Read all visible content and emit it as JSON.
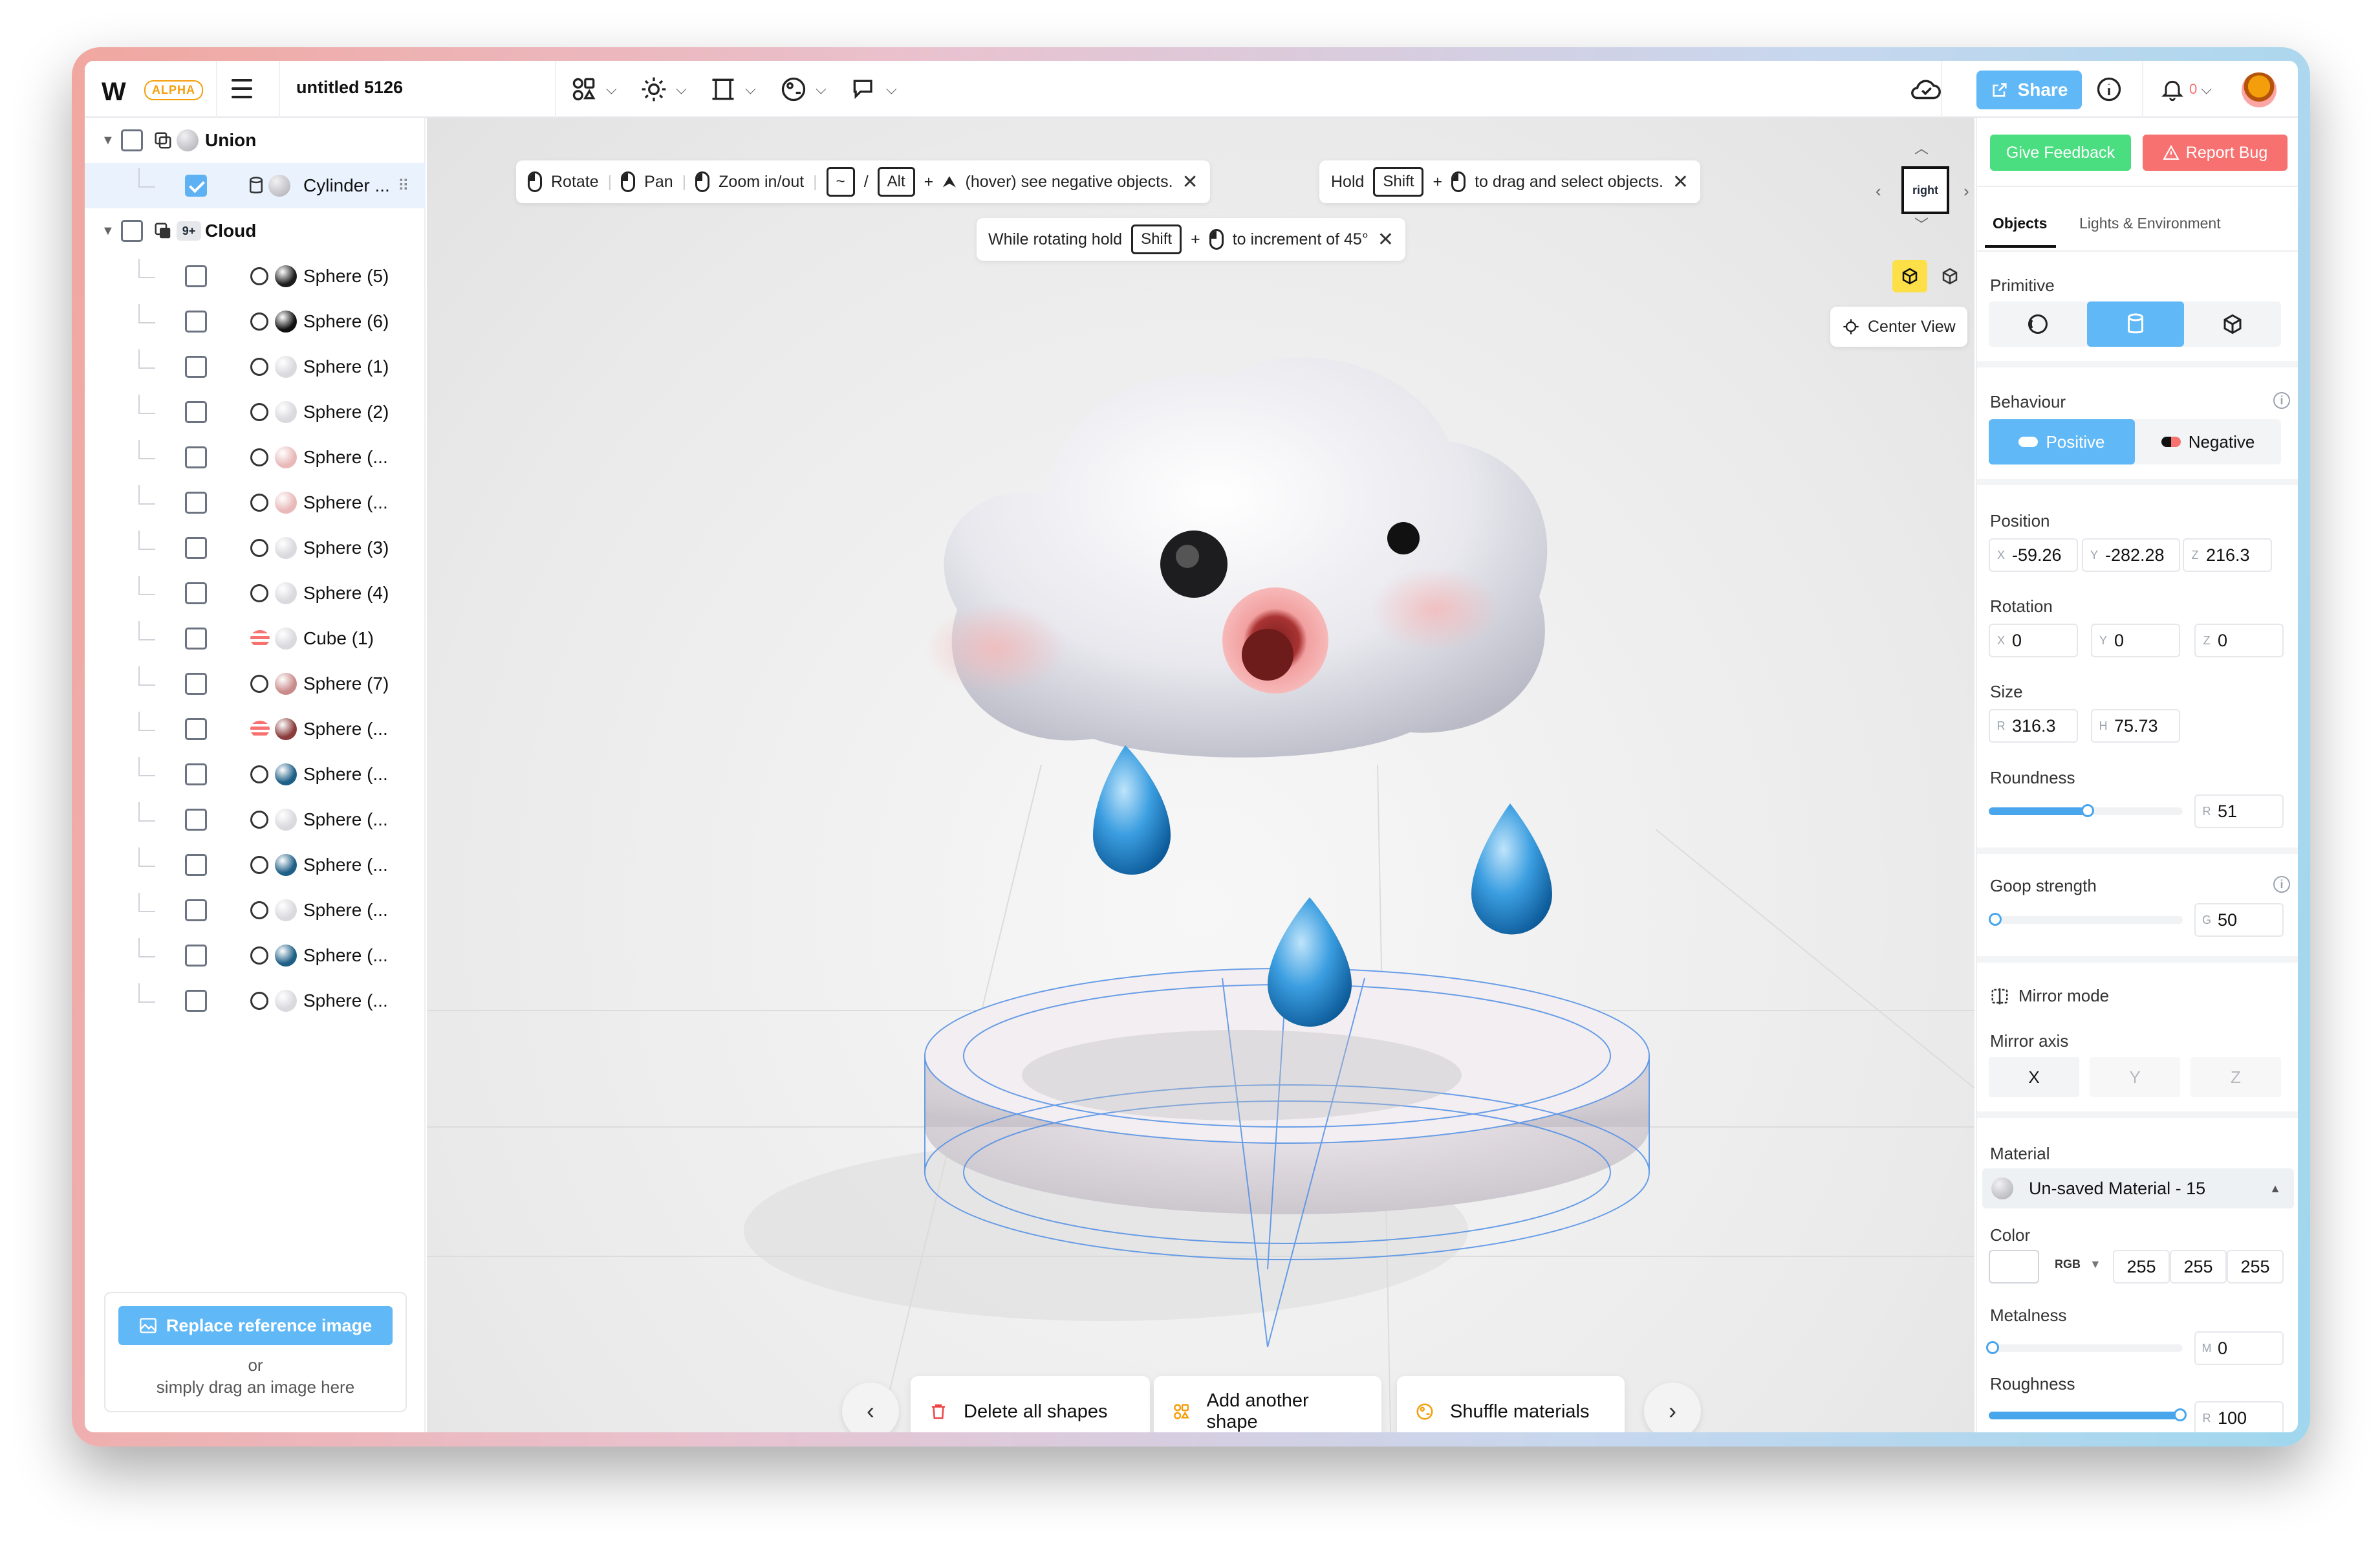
{
  "header": {
    "logo": "W",
    "badge": "ALPHA",
    "title": "untitled 5126",
    "share_label": "Share",
    "notification_count": "0"
  },
  "outline": {
    "root": "Union",
    "selected": "Cylinder ...",
    "group_badge": "9+",
    "group": "Cloud",
    "items": [
      {
        "label": "Sphere (5)",
        "icon": "sphere",
        "color": "#1c1c1c"
      },
      {
        "label": "Sphere (6)",
        "icon": "sphere",
        "color": "#111111"
      },
      {
        "label": "Sphere (1)",
        "icon": "sphere",
        "color": "#d9d9de"
      },
      {
        "label": "Sphere (2)",
        "icon": "sphere",
        "color": "#d9d9de"
      },
      {
        "label": "Sphere (...",
        "icon": "sphere",
        "color": "#e8b9b8"
      },
      {
        "label": "Sphere (...",
        "icon": "sphere",
        "color": "#e8b9b8"
      },
      {
        "label": "Sphere (3)",
        "icon": "sphere",
        "color": "#d9d9de"
      },
      {
        "label": "Sphere (4)",
        "icon": "sphere",
        "color": "#d9d9de"
      },
      {
        "label": "Cube (1)",
        "icon": "cube",
        "color": "#d9d9de"
      },
      {
        "label": "Sphere (7)",
        "icon": "sphere",
        "color": "#c98a8a"
      },
      {
        "label": "Sphere (...",
        "icon": "cube",
        "color": "#8a3b3b"
      },
      {
        "label": "Sphere (...",
        "icon": "sphere",
        "color": "#1e5f86"
      },
      {
        "label": "Sphere (...",
        "icon": "sphere",
        "color": "#d9d9de"
      },
      {
        "label": "Sphere (...",
        "icon": "sphere",
        "color": "#1e5f86"
      },
      {
        "label": "Sphere (...",
        "icon": "sphere",
        "color": "#d9d9de"
      },
      {
        "label": "Sphere (...",
        "icon": "sphere",
        "color": "#1e5f86"
      },
      {
        "label": "Sphere (...",
        "icon": "sphere",
        "color": "#d9d9de"
      }
    ],
    "replace_label": "Replace reference image",
    "or_label": "or",
    "drag_label": "simply drag an image here"
  },
  "hints": {
    "rotate": "Rotate",
    "pan": "Pan",
    "zoom": "Zoom in/out",
    "tilde": "~",
    "slash": "/",
    "alt": "Alt",
    "plus": "+",
    "negative": "(hover) see negative objects.",
    "hold": "Hold",
    "shift": "Shift",
    "drag_select": "to drag and select objects.",
    "while_rotating": "While rotating hold",
    "increment": "to increment of 45°"
  },
  "view": {
    "cube_label": "right",
    "center_view": "Center View"
  },
  "actions": {
    "delete": "Delete all shapes",
    "add": "Add another shape",
    "shuffle": "Shuffle materials"
  },
  "panel": {
    "feedback": "Give Feedback",
    "report": "Report Bug",
    "tab_objects": "Objects",
    "tab_lights": "Lights & Environment",
    "primitive_label": "Primitive",
    "behaviour_label": "Behaviour",
    "positive": "Positive",
    "negative": "Negative",
    "position_label": "Position",
    "position": {
      "x": "-59.26",
      "y": "-282.28",
      "z": "216.3"
    },
    "rotation_label": "Rotation",
    "rotation": {
      "x": "0",
      "y": "0",
      "z": "0"
    },
    "size_label": "Size",
    "size": {
      "r": "316.3",
      "h": "75.73"
    },
    "roundness_label": "Roundness",
    "roundness": "51",
    "goop_label": "Goop strength",
    "goop": "50",
    "mirror_mode": "Mirror mode",
    "mirror_axis_label": "Mirror axis",
    "axes": [
      "X",
      "Y",
      "Z"
    ],
    "material_label": "Material",
    "material_name": "Un-saved Material - 15",
    "color_label": "Color",
    "color_mode": "RGB",
    "rgb": [
      "255",
      "255",
      "255"
    ],
    "metalness_label": "Metalness",
    "metalness": "0",
    "roughness_label": "Roughness",
    "roughness": "100",
    "axis_letters": {
      "x": "X",
      "y": "Y",
      "z": "Z",
      "r": "R",
      "h": "H",
      "g": "G",
      "m": "M"
    }
  }
}
